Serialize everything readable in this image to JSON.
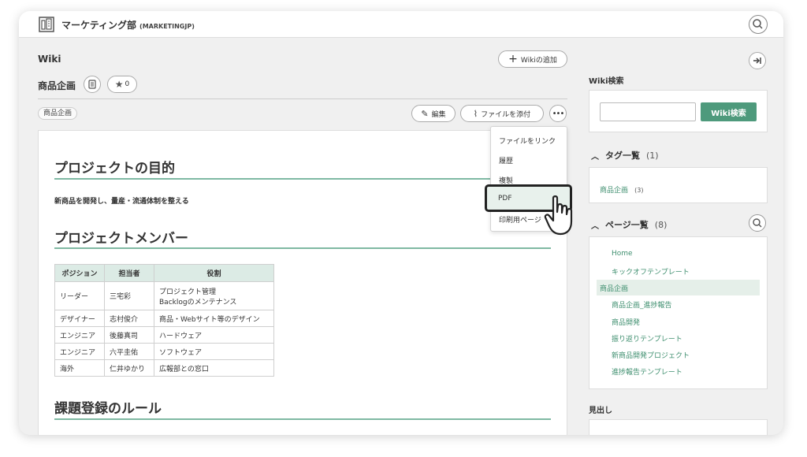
{
  "project": {
    "name": "マーケティング部",
    "key": "(MARKETINGJP)"
  },
  "wiki": {
    "section_label": "Wiki",
    "add_button": "Wikiの追加",
    "page_title": "商品企画",
    "star_count": "0",
    "tag": "商品企画",
    "edit_button": "編集",
    "attach_button": "ファイルを添付",
    "more_button": "•••"
  },
  "dropdown": {
    "items": [
      "ファイルをリンク",
      "履歴",
      "複製",
      "PDF",
      "印刷用ページ"
    ]
  },
  "content": {
    "heading1": "プロジェクトの目的",
    "purpose": "新商品を開発し、量産・流通体制を整える",
    "heading2": "プロジェクトメンバー",
    "table_headers": [
      "ポジション",
      "担当者",
      "役割"
    ],
    "table_rows": [
      [
        "リーダー",
        "三宅彩",
        "プロジェクト管理",
        "Backlogのメンテナンス"
      ],
      [
        "デザイナー",
        "志村俊介",
        "商品・Webサイト等のデザイン",
        ""
      ],
      [
        "エンジニア",
        "後藤真司",
        "ハードウェア",
        ""
      ],
      [
        "エンジニア",
        "六平圭佑",
        "ソフトウェア",
        ""
      ],
      [
        "海外",
        "仁井ゆかり",
        "広報部との窓口",
        ""
      ]
    ],
    "heading3": "課題登録のルール"
  },
  "sidebar": {
    "search_label": "Wiki検索",
    "search_button": "Wiki検索",
    "search_placeholder": "",
    "tags_title": "タグ一覧",
    "tags_count": "(1)",
    "tag_item": "商品企画",
    "tag_item_count": "(3)",
    "pages_title": "ページ一覧",
    "pages_count": "(8)",
    "pages": [
      "Home",
      "キックオフテンプレート",
      "商品企画",
      "商品企画_進捗報告",
      "商品開発",
      "振り返りテンプレート",
      "新商品開発プロジェクト",
      "進捗報告テンプレート"
    ],
    "outline_label": "見出し"
  },
  "colors": {
    "accent": "#4e9a7c",
    "link": "#3f8f6f",
    "heading_rule": "#7fb9a3",
    "table_header": "#dcebe5"
  }
}
